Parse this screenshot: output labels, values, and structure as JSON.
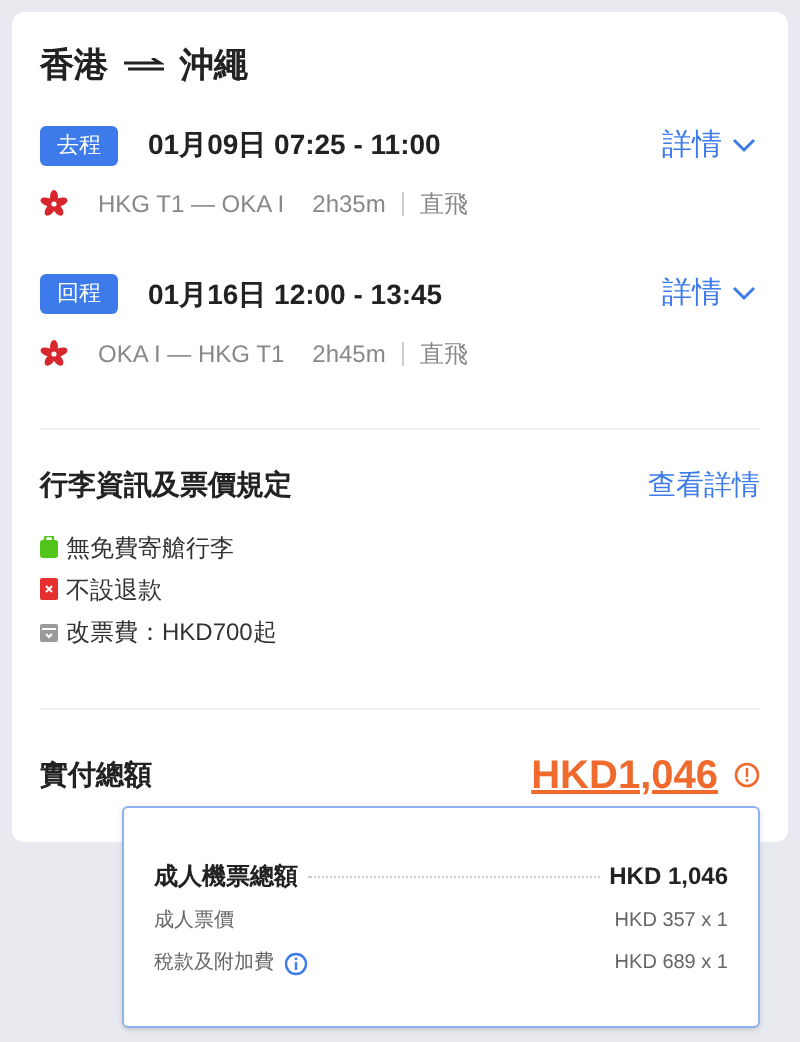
{
  "route": {
    "from": "香港",
    "to": "沖繩"
  },
  "segments": [
    {
      "badge": "去程",
      "time": "01月09日 07:25 - 11:00",
      "details_link": "詳情",
      "route": "HKG T1 — OKA I",
      "duration": "2h35m",
      "stops": "直飛"
    },
    {
      "badge": "回程",
      "time": "01月16日 12:00 - 13:45",
      "details_link": "詳情",
      "route": "OKA I — HKG T1",
      "duration": "2h45m",
      "stops": "直飛"
    }
  ],
  "baggage": {
    "title": "行李資訊及票價規定",
    "link": "查看詳情",
    "items": [
      {
        "kind": "baggage",
        "text": "無免費寄艙行李"
      },
      {
        "kind": "refund",
        "text": "不設退款"
      },
      {
        "kind": "change",
        "text": "改票費：HKD700起"
      }
    ]
  },
  "total": {
    "label": "實付總額",
    "amount": "HKD1,046"
  },
  "breakdown": {
    "title": "成人機票總額",
    "amount": "HKD 1,046",
    "rows": [
      {
        "label": "成人票價",
        "value": "HKD 357 x 1",
        "info": false
      },
      {
        "label": "稅款及附加費",
        "value": "HKD 689 x 1",
        "info": true
      }
    ]
  }
}
